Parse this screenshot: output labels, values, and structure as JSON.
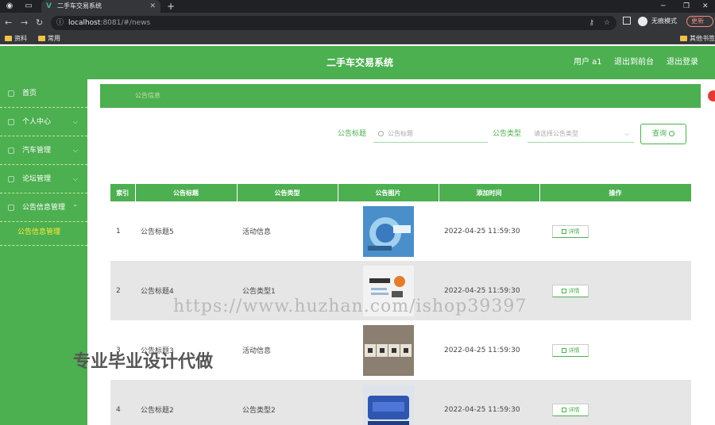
{
  "browser": {
    "tab_title": "二手车交易系统",
    "url_host": "localhost",
    "url_path": ":8081/#/news",
    "incognito_label": "无痕模式",
    "update_label": "更新",
    "bookmarks": [
      "资料",
      "常用"
    ],
    "other_bookmarks": "其他书签"
  },
  "header": {
    "title": "二手车交易系统",
    "user": "用户 a1",
    "back_frontend": "退出到前台",
    "logout": "退出登录"
  },
  "sidebar": {
    "items": [
      {
        "label": "首页"
      },
      {
        "label": "个人中心"
      },
      {
        "label": "汽车管理"
      },
      {
        "label": "论坛管理"
      },
      {
        "label": "公告信息管理"
      }
    ],
    "active_sub": "公告信息管理"
  },
  "breadcrumb": "公告信息",
  "search": {
    "title_label": "公告标题",
    "title_placeholder": "公告标题",
    "type_label": "公告类型",
    "type_placeholder": "请选择公告类型",
    "query_label": "查询"
  },
  "table": {
    "headers": [
      "索引",
      "公告标题",
      "公告类型",
      "公告图片",
      "添加时间",
      "操作"
    ],
    "detail_label": "详情",
    "rows": [
      {
        "index": "1",
        "title": "公告标题5",
        "type": "活动信息",
        "image": "news-globe-thumb",
        "time": "2022-04-25 11:59:30"
      },
      {
        "index": "2",
        "title": "公告标题4",
        "type": "公告类型1",
        "image": "news-megaphone-thumb",
        "time": "2022-04-25 11:59:30"
      },
      {
        "index": "3",
        "title": "公告标题3",
        "type": "活动信息",
        "image": "news-blocks-thumb",
        "time": "2022-04-25 11:59:30"
      },
      {
        "index": "4",
        "title": "公告标题2",
        "type": "公告类型2",
        "image": "news-key-thumb",
        "time": "2022-04-25 11:59:30"
      }
    ]
  },
  "overlay": {
    "url_watermark": "https://www.huzhan.com/ishop39397",
    "text_watermark": "专业毕业设计代做"
  },
  "colors": {
    "primary": "#4caf50",
    "accent_text": "#ffeb3b",
    "header_bg": "#4caf50"
  }
}
